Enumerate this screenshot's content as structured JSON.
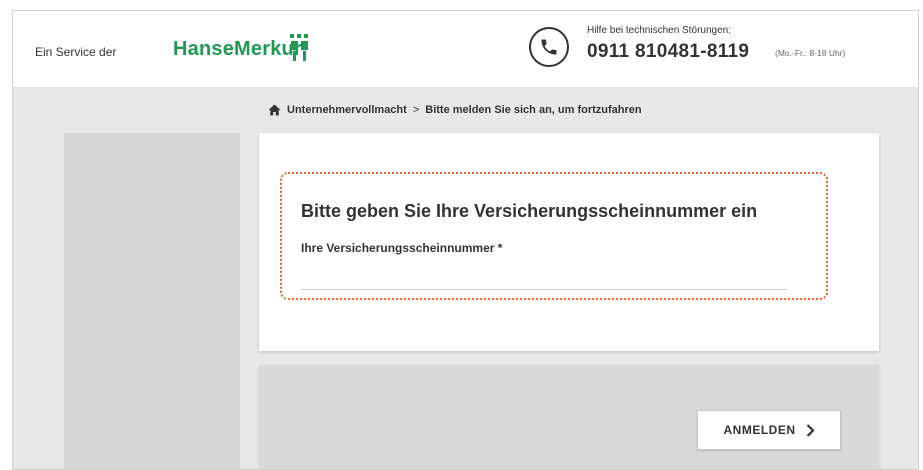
{
  "header": {
    "service_text": "Ein Service der",
    "brand_name": "HanseMerkur",
    "help_label": "Hilfe bei technischen Störungen:",
    "help_phone": "0911 810481-8119",
    "help_hours": "(Mo.-Fr.: 8-18 Uhr)"
  },
  "breadcrumb": {
    "home_icon": "home-icon",
    "item_1": "Unternehmervollmacht",
    "separator": ">",
    "item_2": "Bitte melden Sie sich an, um fortzufahren"
  },
  "form": {
    "title": "Bitte geben Sie Ihre Versicherungsscheinnummer ein",
    "field_label": "Ihre Versicherungsscheinnummer *",
    "field_value": ""
  },
  "actions": {
    "login_label": "ANMELDEN",
    "login_icon": "chevron-right-icon"
  },
  "colors": {
    "brand_green": "#1f9a55",
    "highlight_orange": "#e0622a"
  }
}
